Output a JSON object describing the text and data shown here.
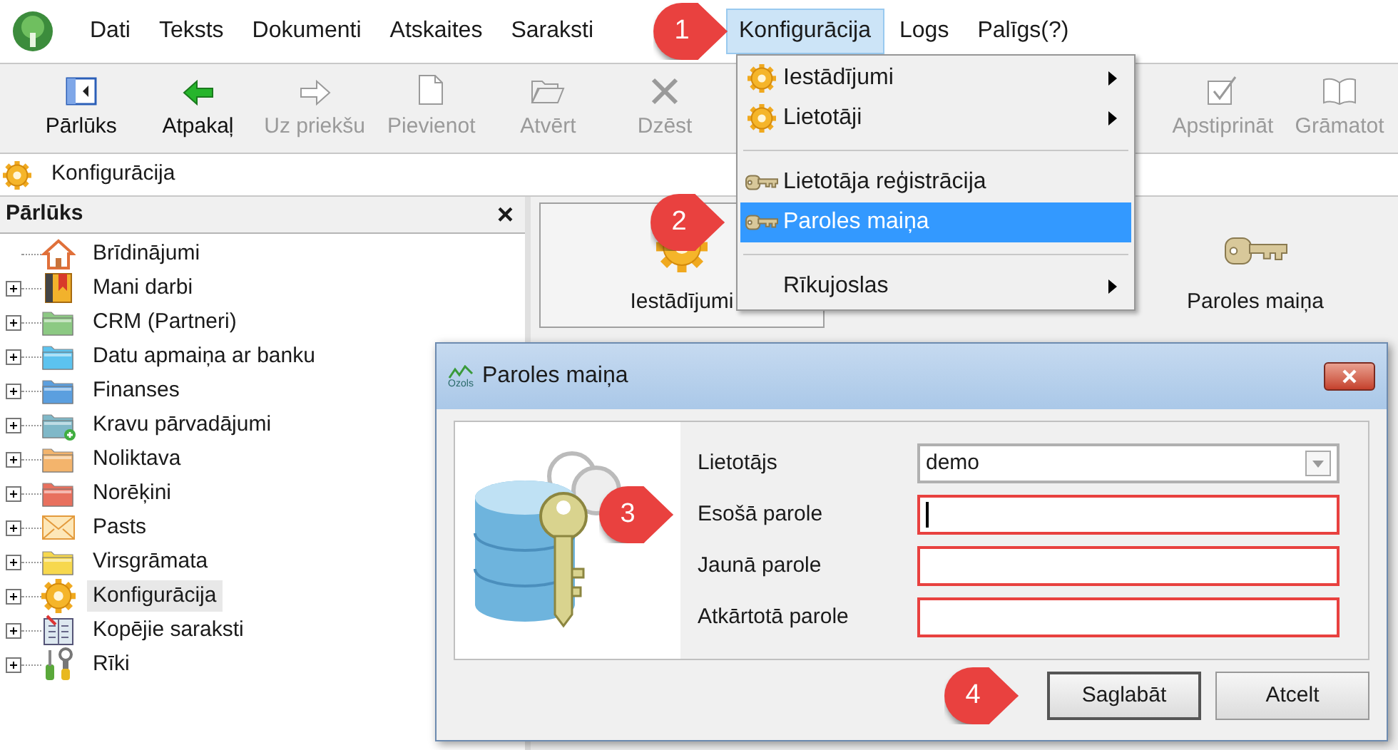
{
  "menu_bar": [
    {
      "label": "Dati",
      "selected": false
    },
    {
      "label": "Teksts",
      "selected": false
    },
    {
      "label": "Dokumenti",
      "selected": false
    },
    {
      "label": "Atskaites",
      "selected": false
    },
    {
      "label": "Saraksti",
      "selected": false
    },
    {
      "label": "Konfigurācija",
      "selected": true
    },
    {
      "label": "Logs",
      "selected": false
    },
    {
      "label": "Palīgs(?)",
      "selected": false
    }
  ],
  "toolbar": [
    {
      "label": "Pārlūks",
      "kind": "panel",
      "disabled": false
    },
    {
      "label": "Atpakaļ",
      "kind": "back",
      "disabled": false
    },
    {
      "label": "Uz priekšu",
      "kind": "forward",
      "disabled": true
    },
    {
      "label": "Pievienot",
      "kind": "page",
      "disabled": true
    },
    {
      "label": "Atvērt",
      "kind": "folder",
      "disabled": true
    },
    {
      "label": "Dzēst",
      "kind": "delete",
      "disabled": true
    },
    {
      "label": "Apstiprināt",
      "kind": "check",
      "disabled": true
    },
    {
      "label": "Grāmatot",
      "kind": "book",
      "disabled": true
    }
  ],
  "path_bar": {
    "label": "Konfigurācija"
  },
  "browser_panel": {
    "title": "Pārlūks",
    "close": "×",
    "tree": [
      {
        "label": "Brīdinājumi",
        "kind": "home",
        "expandable": false,
        "selected": false
      },
      {
        "label": "Mani darbi",
        "kind": "binder",
        "expandable": true,
        "selected": false
      },
      {
        "label": "CRM (Partneri)",
        "kind": "folder",
        "color": "#8cc983",
        "expandable": true,
        "selected": false
      },
      {
        "label": "Datu apmaiņa ar banku",
        "kind": "folder",
        "color": "#5cc3ef",
        "expandable": true,
        "selected": false
      },
      {
        "label": "Finanses",
        "kind": "folder",
        "color": "#5b9fdf",
        "expandable": true,
        "selected": false
      },
      {
        "label": "Kravu pārvadājumi",
        "kind": "newfolder",
        "color": "#7fb8c8",
        "expandable": true,
        "selected": false
      },
      {
        "label": "Noliktava",
        "kind": "folder",
        "color": "#f3b46c",
        "expandable": true,
        "selected": false
      },
      {
        "label": "Norēķini",
        "kind": "folder",
        "color": "#e8705e",
        "expandable": true,
        "selected": false
      },
      {
        "label": "Pasts",
        "kind": "mail",
        "expandable": true,
        "selected": false
      },
      {
        "label": "Virsgrāmata",
        "kind": "folder",
        "color": "#f7d84d",
        "expandable": true,
        "selected": false
      },
      {
        "label": "Konfigurācija",
        "kind": "gear",
        "expandable": true,
        "selected": true
      },
      {
        "label": "Kopējie saraksti",
        "kind": "list",
        "expandable": true,
        "selected": false
      },
      {
        "label": "Rīki",
        "kind": "tools",
        "expandable": true,
        "selected": false
      }
    ]
  },
  "tiles": [
    {
      "label": "Iestādījumi",
      "kind": "gear",
      "selected": true
    },
    {
      "label": "Paroles maiņa",
      "kind": "key",
      "selected": false
    }
  ],
  "dropdown_menu": [
    {
      "kind": "gear",
      "label": "Iestādījumi",
      "submenu": true,
      "selected": false
    },
    {
      "kind": "gear",
      "label": "Lietotāji",
      "submenu": true,
      "selected": false
    },
    {
      "kind": "separator"
    },
    {
      "kind": "key",
      "label": "Lietotāja reģistrācija",
      "submenu": false,
      "selected": false
    },
    {
      "kind": "key",
      "label": "Paroles maiņa",
      "submenu": false,
      "selected": true
    },
    {
      "kind": "separator"
    },
    {
      "kind": "plain",
      "label": "Rīkujoslas",
      "submenu": true,
      "selected": false
    }
  ],
  "dialog": {
    "title": "Paroles maiņa",
    "logo_text": "Ozols",
    "fields": [
      {
        "kind": "select",
        "label": "Lietotājs",
        "value": "demo",
        "highlighted": false
      },
      {
        "kind": "password",
        "label": "Esošā parole",
        "highlighted": true,
        "focused": true
      },
      {
        "kind": "password",
        "label": "Jaunā parole",
        "highlighted": true,
        "focused": false
      },
      {
        "kind": "password",
        "label": "Atkārtotā parole",
        "highlighted": true,
        "focused": false
      }
    ],
    "buttons": [
      {
        "label": "Saglabāt",
        "default": true
      },
      {
        "label": "Atcelt",
        "default": false
      }
    ]
  },
  "callouts": [
    "1",
    "2",
    "3",
    "4"
  ]
}
